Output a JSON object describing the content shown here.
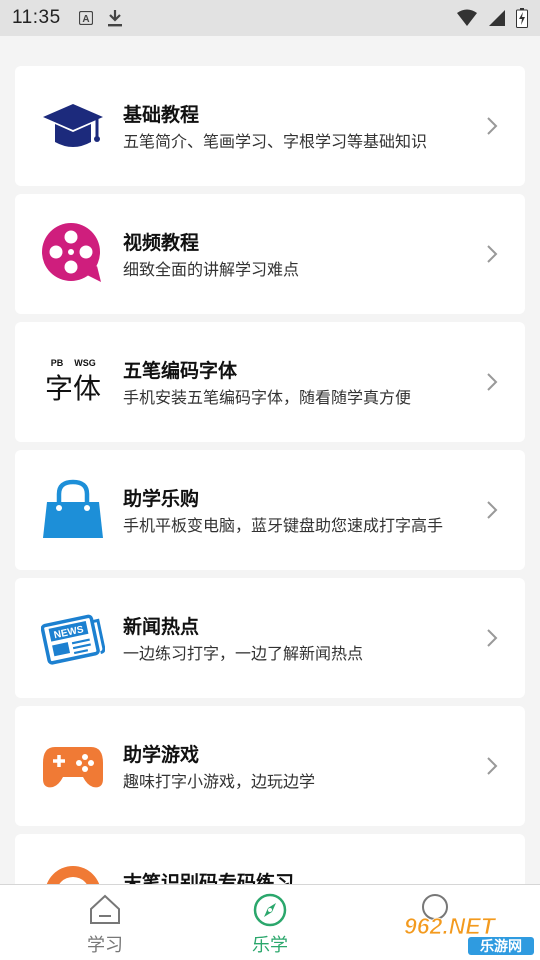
{
  "status_bar": {
    "time": "11:35",
    "icons": [
      "text-a-icon",
      "download-icon",
      "wifi-icon",
      "signal-icon",
      "battery-icon"
    ]
  },
  "list": {
    "items": [
      {
        "title": "基础教程",
        "subtitle": "五笔简介、笔画学习、字根学习等基础知识",
        "icon": "graduation-cap-icon"
      },
      {
        "title": "视频教程",
        "subtitle": "细致全面的讲解学习难点",
        "icon": "film-reel-icon"
      },
      {
        "title": "五笔编码字体",
        "subtitle": "手机安装五笔编码字体，随看随学真方便",
        "icon": "font-glyph-icon",
        "icon_text": {
          "main": "字体",
          "top_left": "PB",
          "top_right": "WSG"
        }
      },
      {
        "title": "助学乐购",
        "subtitle": "手机平板变电脑，蓝牙键盘助您速成打字高手",
        "icon": "shopping-bag-icon"
      },
      {
        "title": "新闻热点",
        "subtitle": "一边练习打字，一边了解新闻热点",
        "icon": "newspaper-icon",
        "icon_text": "NEWS"
      },
      {
        "title": "助学游戏",
        "subtitle": "趣味打字小游戏，边玩边学",
        "icon": "gamepad-icon"
      },
      {
        "title": "末笔识别码专码练习",
        "subtitle": "",
        "icon": "target-icon"
      }
    ]
  },
  "tab_bar": {
    "tabs": [
      {
        "label": "学习",
        "icon": "home-icon",
        "active": false
      },
      {
        "label": "乐学",
        "icon": "compass-icon",
        "active": true
      },
      {
        "label": "",
        "icon": "profile-icon",
        "active": false
      }
    ]
  },
  "watermark": {
    "brand": "962.NET",
    "site": "乐游网"
  },
  "colors": {
    "accent": "#2ba76c",
    "card_bg": "#ffffff",
    "page_bg": "#f4f4f4",
    "status_bg": "#e2e2e2",
    "cap_navy": "#1c2a7c",
    "reel_magenta": "#cf1e7d",
    "bag_blue": "#1d8fd8",
    "news_blue": "#1c80d0",
    "game_orange": "#f07a35"
  }
}
